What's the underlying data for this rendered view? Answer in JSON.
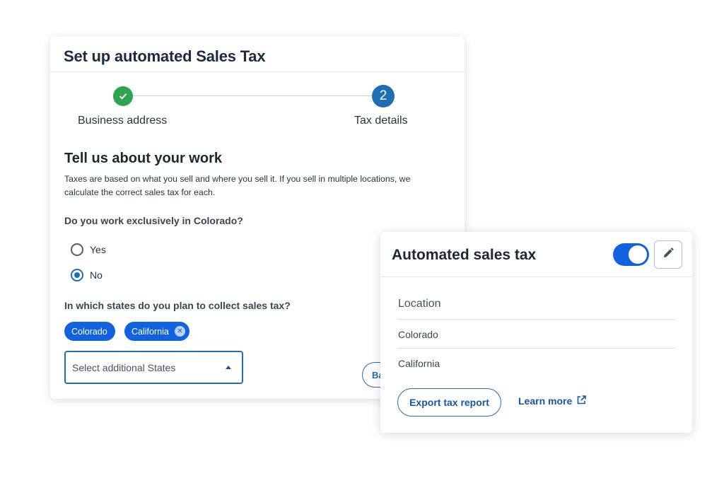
{
  "setup": {
    "title": "Set up automated Sales Tax",
    "steps": [
      {
        "label": "Business address",
        "icon": "check-icon"
      },
      {
        "label": "Tax details",
        "number": "2"
      }
    ],
    "heading": "Tell us about your work",
    "description": "Taxes are based on what you sell and where you sell it. If you sell in multiple locations, we calculate the correct sales tax for each.",
    "question1": "Do you work exclusively in Colorado?",
    "options": [
      {
        "label": "Yes",
        "selected": false
      },
      {
        "label": "No",
        "selected": true
      }
    ],
    "question2": "In which states do you plan to collect sales tax?",
    "chips": [
      "Colorado",
      "California"
    ],
    "select_placeholder": "Select additional States",
    "back_partial": "Ba"
  },
  "tax_panel": {
    "title": "Automated sales tax",
    "toggle_on": true,
    "location_header": "Location",
    "locations": [
      "Colorado",
      "California"
    ],
    "export_label": "Export tax report",
    "learn_more_label": "Learn more"
  },
  "colors": {
    "primary": "#1262e0",
    "step_done": "#2ea44f",
    "step_current": "#1f6fb4",
    "link": "#1556a8"
  }
}
